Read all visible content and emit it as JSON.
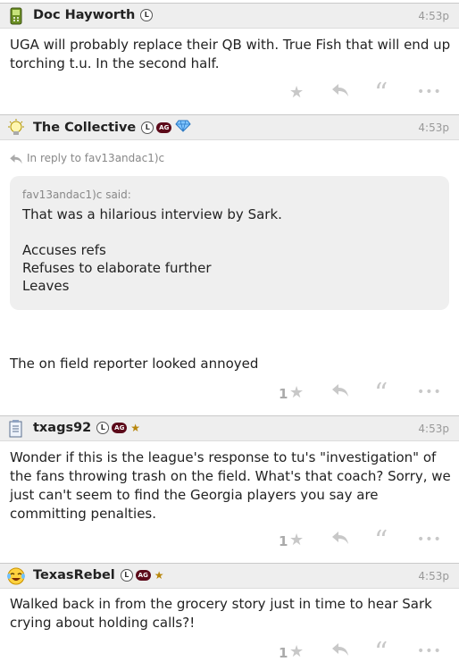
{
  "posts": [
    {
      "username": "Doc Hayworth",
      "time": "4:53p",
      "badges": {
        "l": "L"
      },
      "text": "UGA will probably replace their QB with. True Fish that will end up torching t.u. In the second half."
    },
    {
      "username": "The Collective",
      "time": "4:53p",
      "badges": {
        "l": "L",
        "ag": "AG"
      },
      "reply_to": "In reply to fav13andac1)c",
      "quote": {
        "said": "fav13andac1)c said:",
        "lines": [
          "That was a hilarious interview by Sark.",
          "Accuses refs",
          "Refuses to elaborate further",
          "Leaves"
        ]
      },
      "text": "The on field reporter looked annoyed",
      "likes": "1"
    },
    {
      "username": "txags92",
      "time": "4:53p",
      "badges": {
        "l": "L",
        "ag": "AG"
      },
      "text": "Wonder if this is the league's response to tu's \"investigation\" of the fans throwing trash on the field. What's that coach? Sorry, we just can't seem to find the Georgia players you say are committing penalties.",
      "likes": "1"
    },
    {
      "username": "TexasRebel",
      "time": "4:53p",
      "badges": {
        "l": "L",
        "ag": "AG"
      },
      "text": "Walked back in from the grocery story just in time to hear Sark crying about holding calls?!",
      "likes": "1"
    }
  ],
  "icons": {
    "like": "star-icon",
    "reply": "reply-arrow-icon",
    "quote": "quote-icon",
    "more": "more-dots-icon"
  },
  "colors": {
    "header_bg": "#eeeeee",
    "ag_badge": "#5c0a1a",
    "icon_gray": "#c8c8c8"
  }
}
